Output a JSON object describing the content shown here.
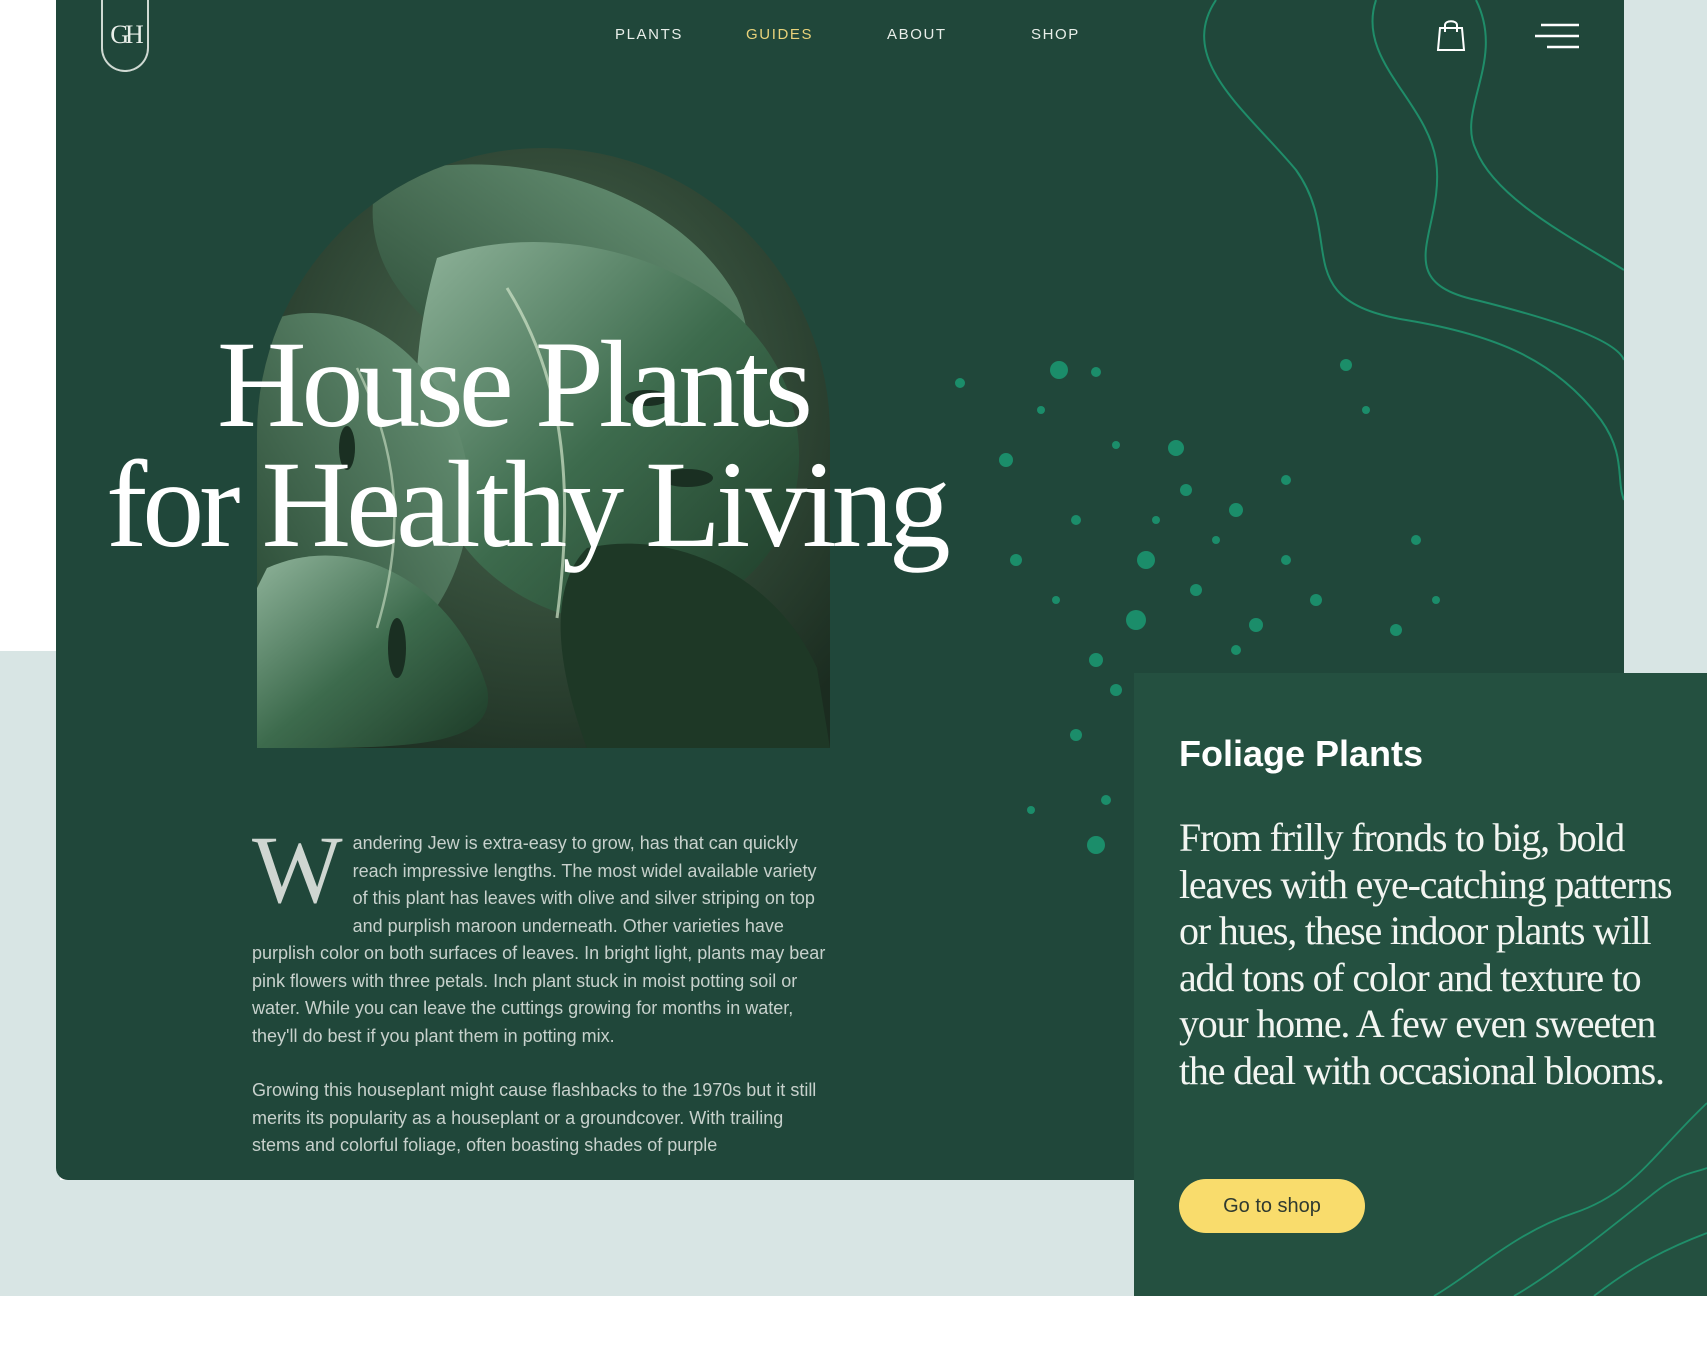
{
  "brand": {
    "logo_text": "GH"
  },
  "nav": {
    "items": [
      {
        "label": "PLANTS",
        "active": false
      },
      {
        "label": "GUIDES",
        "active": true
      },
      {
        "label": "ABOUT",
        "active": false
      },
      {
        "label": "SHOP",
        "active": false
      }
    ]
  },
  "header_icons": {
    "cart": "shopping-bag-icon",
    "menu": "hamburger-menu-icon"
  },
  "hero": {
    "title_line1": "House Plants",
    "title_line2": "for Healthy Living"
  },
  "article": {
    "drop_cap": "W",
    "paragraph1": "andering Jew is extra-easy to grow, has that can quickly reach impressive lengths. The most widel available variety of this plant has leaves with olive and silver striping on top and purplish maroon underneath. Other varieties have purplish color on both surfaces of leaves. In bright light, plants may bear pink flowers with three petals. Inch plant stuck in moist potting soil or water. While you can leave the cuttings growing for months in water, they'll do best if you plant them in potting mix.",
    "paragraph2": "Growing this houseplant might cause flashbacks to the 1970s but it still merits its popularity as a houseplant or a groundcover. With trailing stems and colorful foliage, often boasting shades of purple"
  },
  "card": {
    "heading": "Foliage Plants",
    "body": "From frilly fronds to big, bold leaves with eye-catching patterns or hues, these indoor plants will add tons of color and texture to your home. A few even sweeten the deal with occasional blooms.",
    "button_label": "Go to shop"
  },
  "colors": {
    "hero_bg": "#20473a",
    "card_bg": "#245040",
    "accent_yellow": "#f9dc6c",
    "nav_active": "#e8d27a",
    "page_bg": "#d8e5e4",
    "topo_line": "#1f9a72"
  }
}
